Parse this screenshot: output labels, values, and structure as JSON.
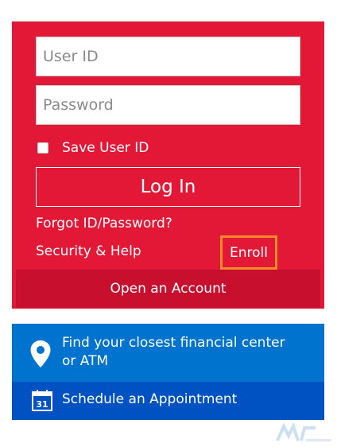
{
  "login": {
    "user_id_placeholder": "User ID",
    "password_placeholder": "Password",
    "save_user_id_label": "Save User ID",
    "save_user_id_checked": false,
    "login_button_label": "Log In",
    "forgot_link": "Forgot ID/Password?",
    "security_link": "Security & Help",
    "enroll_link": "Enroll",
    "open_account_label": "Open an Account"
  },
  "locator": {
    "label": "Find your closest financial center or ATM",
    "icon": "location-pin-icon"
  },
  "appointment": {
    "label": "Schedule an Appointment",
    "icon": "calendar-icon",
    "calendar_day": "31"
  },
  "colors": {
    "brand_red": "#e31837",
    "dark_red": "#c8102e",
    "blue": "#0073cf",
    "dark_blue": "#0052c2",
    "highlight_orange": "#f28c28"
  }
}
